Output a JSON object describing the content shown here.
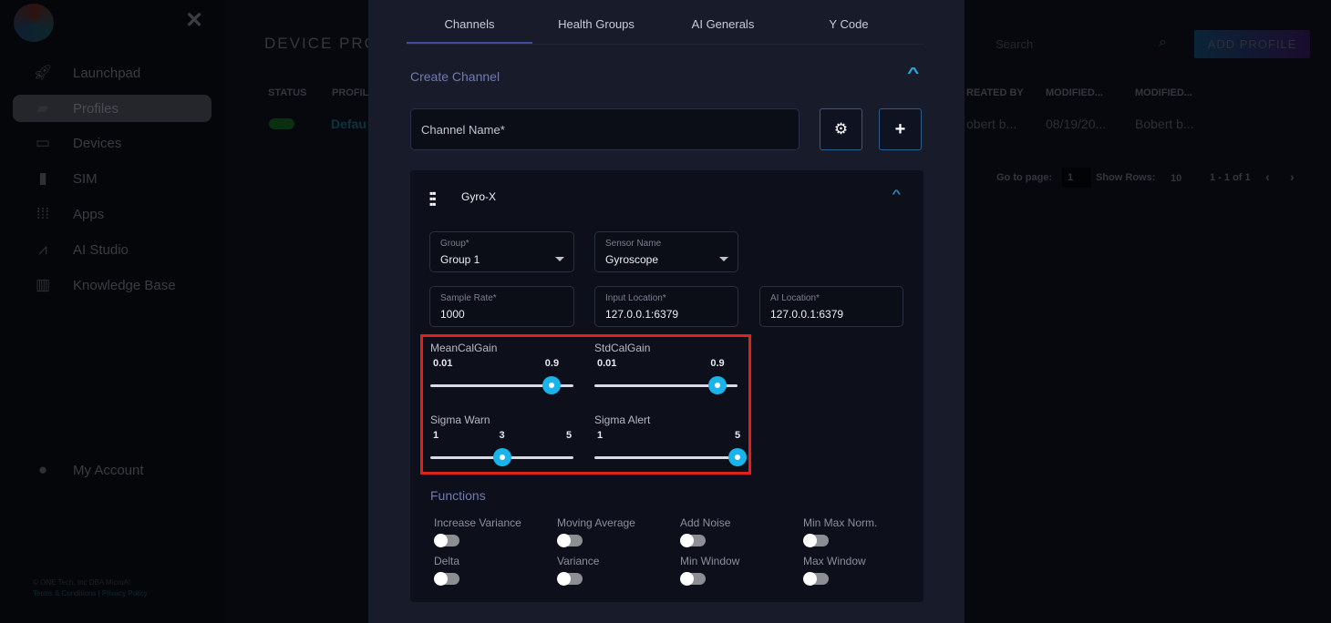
{
  "sidebar": {
    "items": [
      {
        "label": "Launchpad",
        "icon": "rocket-icon"
      },
      {
        "label": "Profiles",
        "icon": "folder-open-icon",
        "active": true
      },
      {
        "label": "Devices",
        "icon": "monitor-icon"
      },
      {
        "label": "SIM",
        "icon": "sim-card-icon"
      },
      {
        "label": "Apps",
        "icon": "grid-icon"
      },
      {
        "label": "AI Studio",
        "icon": "chart-search-icon"
      },
      {
        "label": "Knowledge Base",
        "icon": "books-icon"
      }
    ],
    "account": "My Account",
    "copyright": "© ONE Tech, Inc DBA MicroAI",
    "terms": "Terms & Conditions",
    "privacy": "Privacy Policy",
    "separator": "|"
  },
  "background": {
    "title": "DEVICE PRO",
    "search_placeholder": "Search",
    "add_profile": "ADD PROFILE",
    "columns": [
      "STATUS",
      "PROFIL",
      "REATED BY",
      "MODIFIED...",
      "MODIFIED..."
    ],
    "row": {
      "profile": "Defau",
      "created_by": "obert b...",
      "modified_on": "08/19/20...",
      "modified_by": "Bobert b..."
    },
    "pagination": {
      "goto_label": "Go to page:",
      "page": "1",
      "rows_label": "Show Rows:",
      "rows": "10",
      "range": "1 - 1 of 1"
    }
  },
  "modal": {
    "tabs": [
      "Channels",
      "Health Groups",
      "AI Generals",
      "Y Code"
    ],
    "active_tab": "Channels",
    "section_title": "Create Channel",
    "channel_name_placeholder": "Channel Name*",
    "channel": {
      "name": "Gyro-X",
      "group": {
        "label": "Group*",
        "value": "Group 1"
      },
      "sensor": {
        "label": "Sensor Name",
        "value": "Gyroscope"
      },
      "sample_rate": {
        "label": "Sample Rate*",
        "value": "1000"
      },
      "input_location": {
        "label": "Input Location*",
        "value": "127.0.0.1:6379"
      },
      "ai_location": {
        "label": "AI Location*",
        "value": "127.0.0.1:6379"
      },
      "sliders": [
        {
          "label": "MeanCalGain",
          "min": "0.01",
          "value": "0.9",
          "fill": 0.85
        },
        {
          "label": "StdCalGain",
          "min": "0.01",
          "value": "0.9",
          "fill": 0.86
        },
        {
          "label": "Sigma Warn",
          "min": "1",
          "value": "3",
          "max": "5",
          "fill": 0.5
        },
        {
          "label": "Sigma Alert",
          "min": "1",
          "value": "5",
          "fill": 1.0
        }
      ],
      "functions_title": "Functions",
      "functions": [
        {
          "label": "Increase Variance",
          "on": false
        },
        {
          "label": "Moving Average",
          "on": false
        },
        {
          "label": "Add Noise",
          "on": false
        },
        {
          "label": "Min Max Norm.",
          "on": false
        },
        {
          "label": "Delta",
          "on": false
        },
        {
          "label": "Variance",
          "on": false
        },
        {
          "label": "Min Window",
          "on": false
        },
        {
          "label": "Max Window",
          "on": false
        }
      ]
    }
  },
  "colors": {
    "accent": "#18b4ea",
    "highlight_box": "#e0201b",
    "modal_bg": "#181b2a"
  }
}
